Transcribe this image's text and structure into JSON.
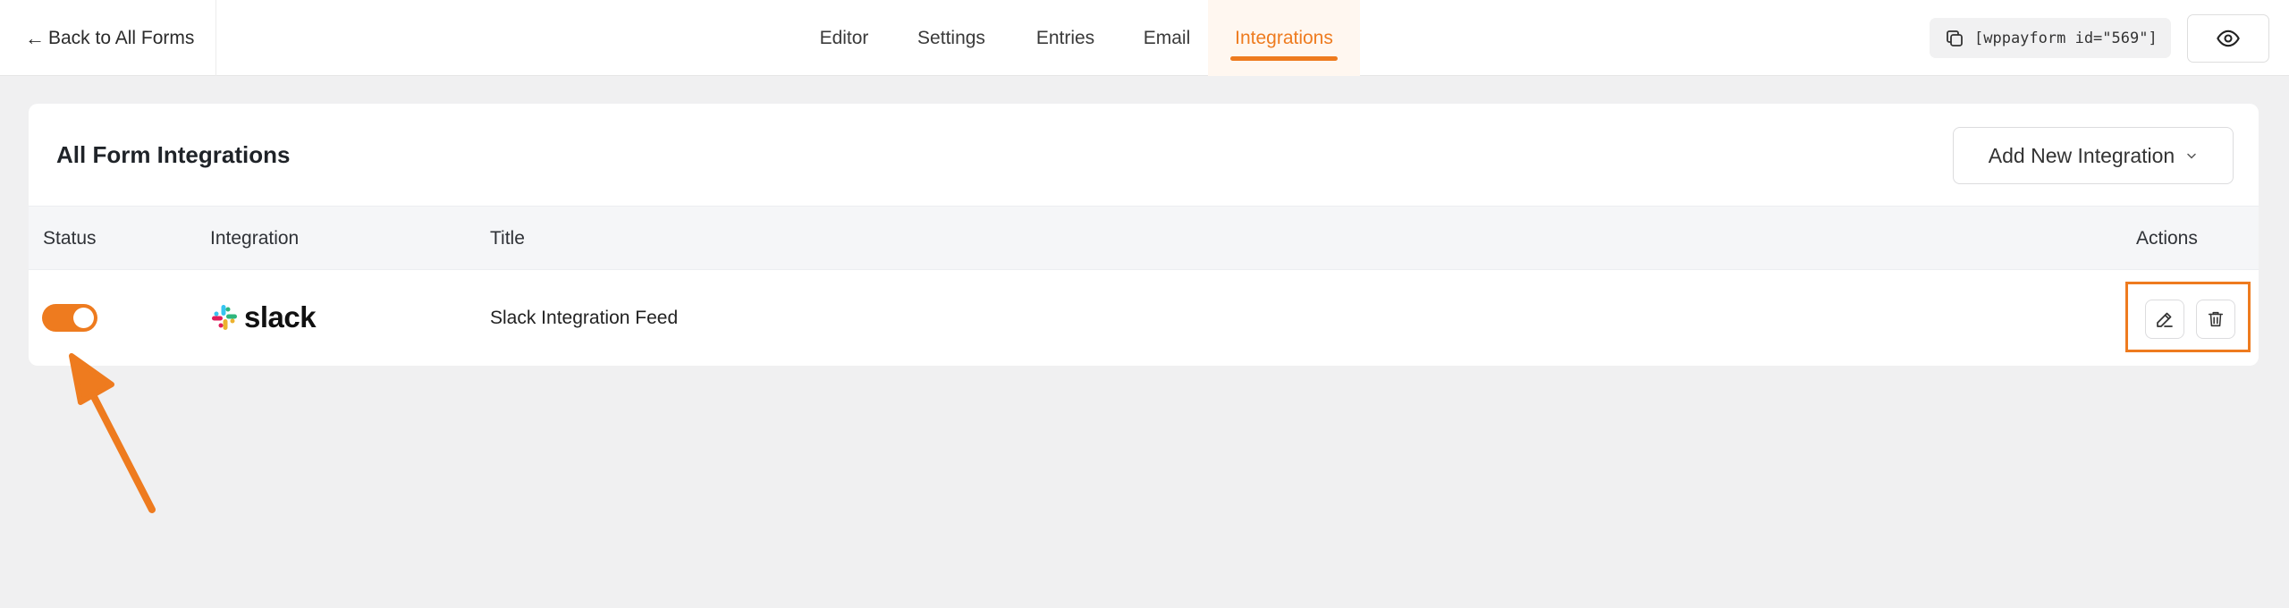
{
  "topbar": {
    "back_label": "Back to All Forms",
    "tabs": [
      {
        "label": "Editor"
      },
      {
        "label": "Settings"
      },
      {
        "label": "Entries"
      },
      {
        "label": "Email"
      },
      {
        "label": "Integrations",
        "active": true
      }
    ],
    "shortcode": "[wppayform id=\"569\"]",
    "preview_icon": "eye-icon",
    "copy_icon": "copy-icon"
  },
  "card": {
    "title": "All Form Integrations",
    "add_button_label": "Add New Integration",
    "table": {
      "headers": {
        "status": "Status",
        "integration": "Integration",
        "title": "Title",
        "actions": "Actions"
      },
      "rows": [
        {
          "status_enabled": true,
          "integration_logo_text": "slack",
          "title": "Slack Integration Feed",
          "actions": [
            "edit-icon",
            "trash-icon"
          ]
        }
      ]
    }
  },
  "colors": {
    "accent": "#ee7b1f",
    "background": "#f0f0f1"
  }
}
